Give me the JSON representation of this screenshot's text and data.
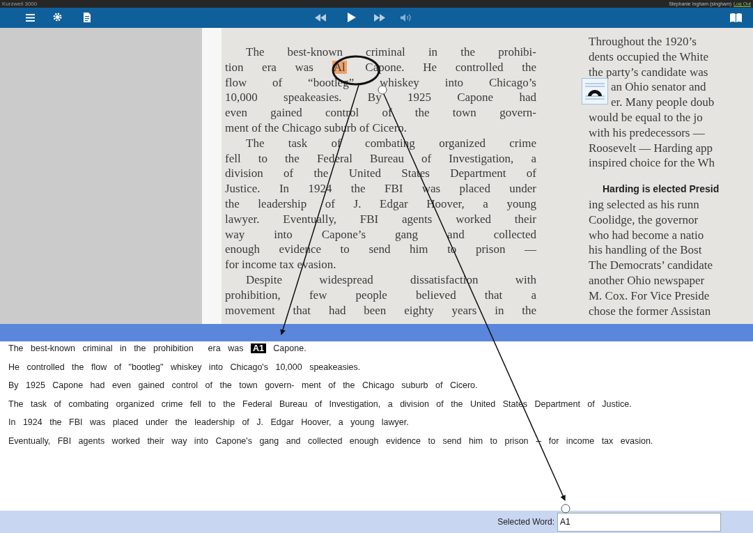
{
  "window": {
    "title": "Kurzweil 3000",
    "user": "Stephanie Ingham (singham)",
    "logout": "Log Out"
  },
  "document": {
    "left_column": [
      {
        "text": "The best-known criminal in the prohibi-",
        "indent": true
      },
      {
        "segments": [
          {
            "text": "tion era was",
            "highlighted": false
          },
          {
            "text": "Al",
            "highlighted": true
          },
          {
            "text": "Capone. He controlled the",
            "highlighted": false
          }
        ]
      },
      {
        "text": "flow of “bootleg” whiskey into Chicago’s"
      },
      {
        "text": "10,000 speakeasies. By 1925 Capone had"
      },
      {
        "text": "even gained control of the town govern-"
      },
      {
        "text": "ment of the Chicago suburb of Cicero.",
        "end": true
      },
      {
        "text": "The task of combating organized crime",
        "indent": true
      },
      {
        "text": "fell to the Federal Bureau of Investigation, a"
      },
      {
        "text": "division of the United States Department of"
      },
      {
        "text": "Justice. In 1924 the FBI was placed under"
      },
      {
        "text": "the leadership of J. Edgar Hoover, a young"
      },
      {
        "text": "lawyer. Eventually, FBI agents worked their"
      },
      {
        "text": "way into Capone’s gang and collected"
      },
      {
        "text": "enough evidence to send him to prison —"
      },
      {
        "text": "for income tax evasion.",
        "end": true
      },
      {
        "text": "Despite widespread dissatisfaction with",
        "indent": true
      },
      {
        "text": "prohibition, few people believed that a"
      },
      {
        "text": "movement that had been eighty years in the"
      }
    ],
    "right_column": [
      {
        "kind": "line",
        "text": "Throughout the 1920’s"
      },
      {
        "kind": "line",
        "text": "dents occupied the White"
      },
      {
        "kind": "line",
        "text": "the party’s candidate was"
      },
      {
        "kind": "line",
        "text": "an Ohio senator and"
      },
      {
        "kind": "line",
        "text": "er. Many people doub"
      },
      {
        "kind": "line",
        "text": "would be equal to the jo"
      },
      {
        "kind": "line",
        "text": "with his predecessors —"
      },
      {
        "kind": "line",
        "text": "Roosevelt — Harding app"
      },
      {
        "kind": "line",
        "text": "inspired choice for the Wh"
      },
      {
        "kind": "heading",
        "text": "Harding is elected Presid"
      },
      {
        "kind": "line",
        "text": "ing selected as his runn"
      },
      {
        "kind": "line",
        "text": "Coolidge, the governor"
      },
      {
        "kind": "line",
        "text": "who had become a natio"
      },
      {
        "kind": "line",
        "text": "his handling of the Bost"
      },
      {
        "kind": "line",
        "text": "The Democrats’ candidate"
      },
      {
        "kind": "line",
        "text": "another Ohio newspaper"
      },
      {
        "kind": "line",
        "text": "M. Cox. For Vice Preside"
      },
      {
        "kind": "line",
        "text": "chose the former Assistan"
      }
    ]
  },
  "sentences": [
    [
      {
        "text": "The best-known criminal in the prohibition  era was",
        "highlighted": false
      },
      {
        "text": "A1",
        "highlighted": true
      },
      {
        "text": "Capone.",
        "highlighted": false
      }
    ],
    [
      {
        "text": "He controlled the flow of \"bootleg\" whiskey into Chicago's 10,000 speakeasies.",
        "highlighted": false
      }
    ],
    [
      {
        "text": "By 1925 Capone had even gained control of the town govern- ment of the Chicago suburb of Cicero.",
        "highlighted": false
      }
    ],
    [
      {
        "text": "The task of combating organized crime fell to the Federal Bureau of Investigation, a division of the United States Department of Justice.",
        "highlighted": false
      }
    ],
    [
      {
        "text": "In 1924 the FBI was placed under the leadership of J. Edgar Hoover, a young lawyer.",
        "highlighted": false
      }
    ],
    [
      {
        "text": "Eventually, FBI agents worked their way into Capone's gang and collected enough evidence to send him to prison -- for income tax evasion.",
        "highlighted": false
      }
    ]
  ],
  "status_bar": {
    "label": "Selected Word:",
    "value": "A1"
  }
}
